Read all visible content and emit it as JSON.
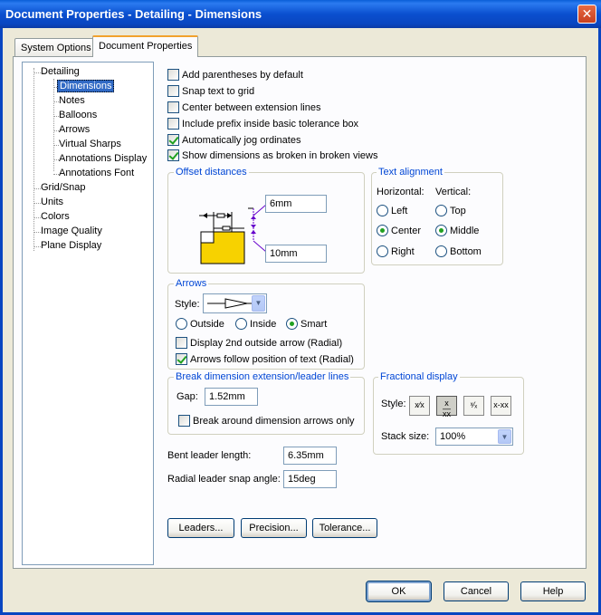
{
  "window": {
    "title": "Document Properties - Detailing - Dimensions",
    "close_glyph": "✕"
  },
  "tabs": [
    {
      "label": "System Options",
      "active": false
    },
    {
      "label": "Document Properties",
      "active": true
    }
  ],
  "tree": {
    "items": [
      {
        "label": "Detailing",
        "level": 0
      },
      {
        "label": "Dimensions",
        "level": 1,
        "selected": true
      },
      {
        "label": "Notes",
        "level": 1
      },
      {
        "label": "Balloons",
        "level": 1
      },
      {
        "label": "Arrows",
        "level": 1
      },
      {
        "label": "Virtual Sharps",
        "level": 1
      },
      {
        "label": "Annotations Display",
        "level": 1
      },
      {
        "label": "Annotations Font",
        "level": 1
      },
      {
        "label": "Grid/Snap",
        "level": 0
      },
      {
        "label": "Units",
        "level": 0
      },
      {
        "label": "Colors",
        "level": 0
      },
      {
        "label": "Image Quality",
        "level": 0
      },
      {
        "label": "Plane Display",
        "level": 0
      }
    ]
  },
  "options": {
    "add_parentheses": {
      "label": "Add parentheses by default",
      "checked": false
    },
    "snap_text": {
      "label": "Snap text to grid",
      "checked": false
    },
    "center_ext": {
      "label": "Center between extension lines",
      "checked": false
    },
    "include_prefix": {
      "label": "Include prefix inside basic tolerance box",
      "checked": false
    },
    "auto_jog": {
      "label": "Automatically jog ordinates",
      "checked": true
    },
    "show_broken": {
      "label": "Show dimensions as broken in broken views",
      "checked": true
    }
  },
  "offset": {
    "title": "Offset distances",
    "top_value": "6mm",
    "bottom_value": "10mm"
  },
  "text_alignment": {
    "title": "Text alignment",
    "horizontal_label": "Horizontal:",
    "vertical_label": "Vertical:",
    "horizontal": [
      {
        "label": "Left",
        "checked": false
      },
      {
        "label": "Center",
        "checked": true
      },
      {
        "label": "Right",
        "checked": false
      }
    ],
    "vertical": [
      {
        "label": "Top",
        "checked": false
      },
      {
        "label": "Middle",
        "checked": true
      },
      {
        "label": "Bottom",
        "checked": false
      }
    ]
  },
  "arrows": {
    "title": "Arrows",
    "style_label": "Style:",
    "placement": [
      {
        "label": "Outside",
        "checked": false
      },
      {
        "label": "Inside",
        "checked": false
      },
      {
        "label": "Smart",
        "checked": true
      }
    ],
    "display_2nd": {
      "label": "Display 2nd outside arrow (Radial)",
      "checked": false
    },
    "follow_text": {
      "label": "Arrows follow position of text (Radial)",
      "checked": true
    }
  },
  "break_dim": {
    "title": "Break dimension extension/leader lines",
    "gap_label": "Gap:",
    "gap_value": "1.52mm",
    "break_around": {
      "label": "Break around dimension arrows only",
      "checked": false
    }
  },
  "fractional": {
    "title": "Fractional display",
    "style_label": "Style:",
    "stack_label": "Stack size:",
    "stack_value": "100%",
    "selected_style": 2
  },
  "bent_leader": {
    "label": "Bent leader length:",
    "value": "6.35mm"
  },
  "radial_snap": {
    "label": "Radial leader snap angle:",
    "value": "15deg"
  },
  "buttons": {
    "leaders": "Leaders...",
    "precision": "Precision...",
    "tolerance": "Tolerance...",
    "ok": "OK",
    "cancel": "Cancel",
    "help": "Help"
  },
  "colors": {
    "titlebar": "#0a4fcf",
    "accent": "#0046d5",
    "selection": "#316ac5",
    "check": "#21a121"
  }
}
